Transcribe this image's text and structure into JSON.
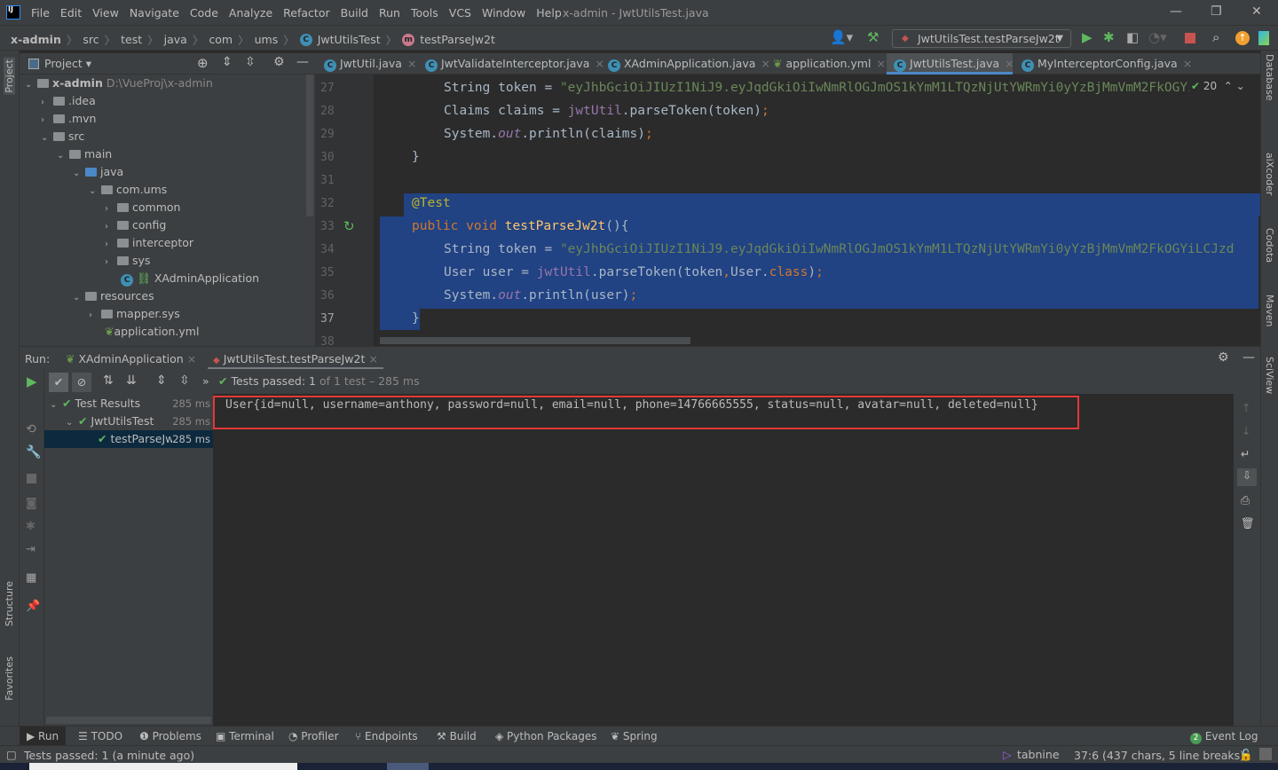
{
  "app": {
    "logo": "IJ",
    "window_title": "x-admin - JwtUtilsTest.java"
  },
  "menu": [
    "File",
    "Edit",
    "View",
    "Navigate",
    "Code",
    "Analyze",
    "Refactor",
    "Build",
    "Run",
    "Tools",
    "VCS",
    "Window",
    "Help"
  ],
  "breadcrumb": [
    "x-admin",
    "src",
    "test",
    "java",
    "com",
    "ums",
    "JwtUtilsTest",
    "testParseJw2t"
  ],
  "toolbar": {
    "run_config": "JwtUtilsTest.testParseJw2t"
  },
  "project": {
    "title": "Project",
    "root": "x-admin",
    "root_path": "D:\\VueProj\\x-admin",
    "items": [
      ".idea",
      ".mvn",
      "src",
      "main",
      "java",
      "com.ums",
      "common",
      "config",
      "interceptor",
      "sys",
      "XAdminApplication",
      "resources",
      "mapper.sys",
      "application.yml"
    ]
  },
  "tabs": [
    "JwtUtil.java",
    "JwtValidateInterceptor.java",
    "XAdminApplication.java",
    "application.yml",
    "JwtUtilsTest.java",
    "MyInterceptorConfig.java"
  ],
  "editor": {
    "line_numbers": [
      "27",
      "28",
      "29",
      "30",
      "31",
      "32",
      "33",
      "34",
      "35",
      "36",
      "37",
      "38"
    ],
    "token_string": "\"eyJhbGciOiJIUzI1NiJ9.eyJqdGkiOiIwNmRlOGJmOS1kYmM1LTQzNjUtYWRmYi0yYzBjMmVmM2FkOGYiLCJzd",
    "inspection_count": "20"
  },
  "right_strip": [
    "Database",
    "aiXcoder",
    "Codota",
    "Maven",
    "SciView"
  ],
  "left_strip": [
    "Project",
    "Structure",
    "Favorites"
  ],
  "run": {
    "label": "Run:",
    "tabs": [
      "XAdminApplication",
      "JwtUtilsTest.testParseJw2t"
    ],
    "status_prefix": "Tests passed:",
    "status_count": "1",
    "status_suffix": "of 1 test – 285 ms",
    "tree": [
      {
        "name": "Test Results",
        "time": "285 ms"
      },
      {
        "name": "JwtUtilsTest",
        "time": "285 ms"
      },
      {
        "name": "testParseJw2t",
        "time": "285 ms"
      }
    ],
    "output": "User{id=null, username=anthony, password=null, email=null, phone=14766665555, status=null, avatar=null, deleted=null}"
  },
  "bottom_tabs": [
    "Run",
    "TODO",
    "Problems",
    "Terminal",
    "Profiler",
    "Endpoints",
    "Build",
    "Python Packages",
    "Spring"
  ],
  "event_log": {
    "count": "2",
    "label": "Event Log"
  },
  "status": {
    "message": "Tests passed: 1 (a minute ago)",
    "tabnine": "tabnine",
    "position": "37:6 (437 chars, 5 line breaks)"
  }
}
